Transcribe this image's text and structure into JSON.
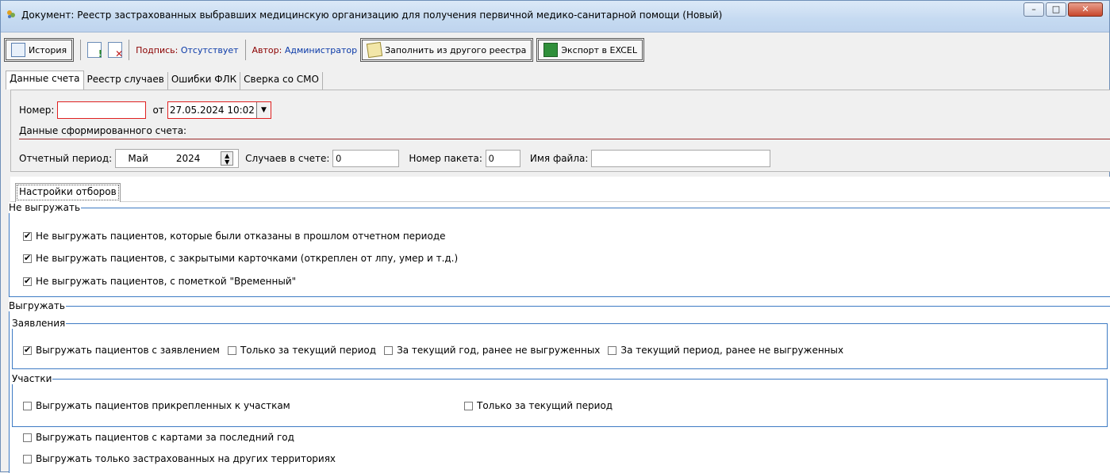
{
  "window": {
    "title": "Документ: Реестр застрахованных выбравших медицинскую организацию для получения первичной медико-санитарной помощи  (Новый)",
    "buttons": {
      "minimize": "–",
      "maximize": "□",
      "close": "✕"
    }
  },
  "toolbar": {
    "history_label": "История",
    "signature_label": "Подпись:",
    "signature_value": "Отсутствует",
    "author_label": "Автор:",
    "author_value": "Администратор",
    "fill_label": "Заполнить из другого реестра",
    "export_label": "Экспорт в EXCEL"
  },
  "tabs": [
    "Данные счета",
    "Реестр случаев",
    "Ошибки ФЛК",
    "Сверка со СМО"
  ],
  "header": {
    "number_label": "Номер:",
    "number_value": "",
    "from_label": "от",
    "date_value": "27.05.2024 10:02",
    "subheading": "Данные сформированного счета:",
    "period_label": "Отчетный период:",
    "period_month": "Май",
    "period_year": "2024",
    "cases_label": "Случаев в счете:",
    "cases_value": "0",
    "package_label": "Номер пакета:",
    "package_value": "0",
    "filename_label": "Имя файла:",
    "filename_value": ""
  },
  "settings_tab": "Настройки отборов",
  "no_export": {
    "legend": "Не выгружать",
    "items": [
      {
        "label": "Не выгружать пациентов, которые были отказаны в прошлом отчетном периоде",
        "checked": true
      },
      {
        "label": "Не выгружать пациентов, с закрытыми карточками (откреплен от лпу, умер и т.д.)",
        "checked": true
      },
      {
        "label": "Не выгружать пациентов, с пометкой \"Временный\"",
        "checked": true
      }
    ]
  },
  "export": {
    "legend": "Выгружать",
    "statements": {
      "legend": "Заявления",
      "items": [
        {
          "label": "Выгружать пациентов с заявлением",
          "checked": true
        },
        {
          "label": "Только за текущий период",
          "checked": false
        },
        {
          "label": "За текущий год, ранее не выгруженных",
          "checked": false
        },
        {
          "label": "За текущий период, ранее не выгруженных",
          "checked": false
        }
      ]
    },
    "sites": {
      "legend": "Участки",
      "items": [
        {
          "label": "Выгружать пациентов прикрепленных к участкам",
          "checked": false
        },
        {
          "label": "Только за текущий период",
          "checked": false
        }
      ]
    },
    "extra": [
      {
        "label": "Выгружать пациентов с картами за последний год",
        "checked": false
      },
      {
        "label": "Выгружать только застрахованных на других территориях",
        "checked": false
      }
    ]
  }
}
